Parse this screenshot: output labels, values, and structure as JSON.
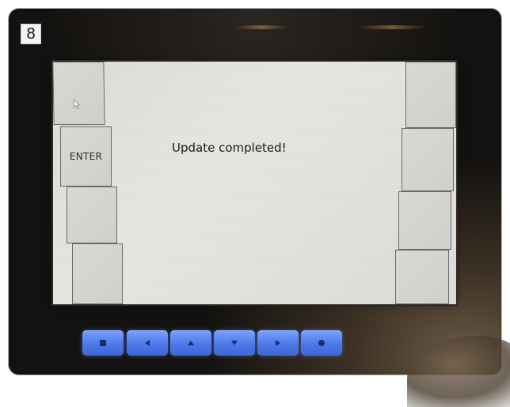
{
  "step_badge": "8",
  "screen": {
    "message": "Update completed!",
    "left_softkeys": [
      {
        "label": "",
        "icon": "mouse-cursor-icon"
      },
      {
        "label": "ENTER"
      },
      {
        "label": ""
      },
      {
        "label": ""
      }
    ],
    "right_softkeys": [
      {
        "label": ""
      },
      {
        "label": ""
      },
      {
        "label": ""
      },
      {
        "label": ""
      }
    ]
  },
  "hardware_keys": [
    {
      "icon": "stop-square-icon"
    },
    {
      "icon": "arrow-left-icon"
    },
    {
      "icon": "arrow-up-icon"
    },
    {
      "icon": "arrow-down-icon"
    },
    {
      "icon": "arrow-right-icon"
    },
    {
      "icon": "circle-icon"
    }
  ],
  "colors": {
    "hardware_key": "#4d78e8",
    "bezel": "#121110",
    "screen": "#e2e2de"
  }
}
